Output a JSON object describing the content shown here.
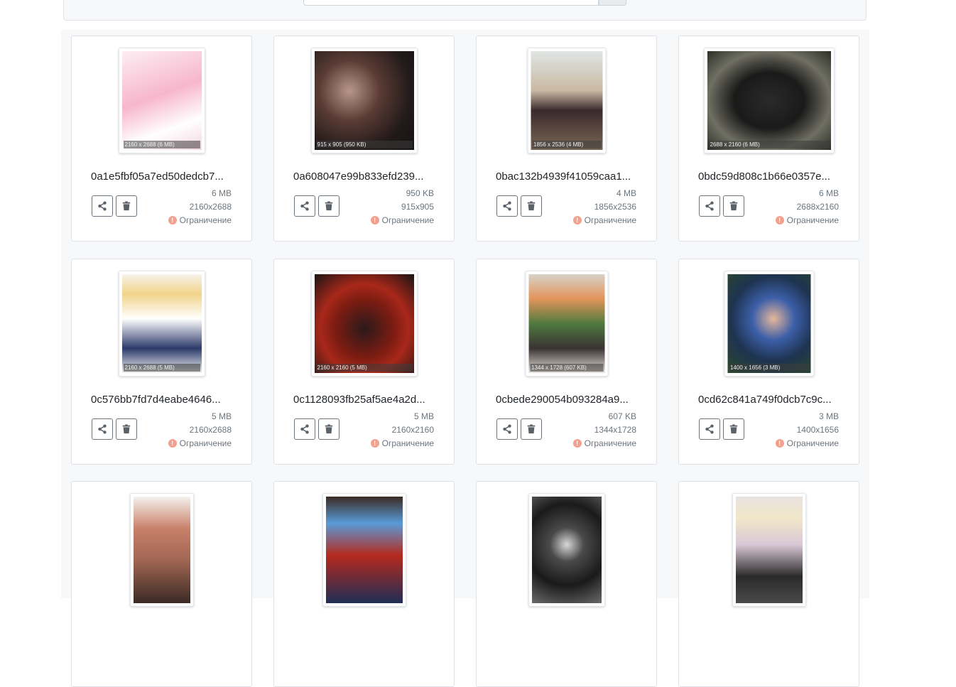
{
  "cards": [
    {
      "name": "0a1e5fbf05a7ed50dedcb7...",
      "size": "6 MB",
      "dims": "2160x2688",
      "restriction": "Ограничение",
      "caption": "2160 x 2688 (6 MB)"
    },
    {
      "name": "0a608047e99b833efd239...",
      "size": "950 KB",
      "dims": "915x905",
      "restriction": "Ограничение",
      "caption": "915 x 905 (950 KB)"
    },
    {
      "name": "0bac132b4939f41059caa1...",
      "size": "4 MB",
      "dims": "1856x2536",
      "restriction": "Ограничение",
      "caption": "1856 x 2536 (4 MB)"
    },
    {
      "name": "0bdc59d808c1b66e0357e...",
      "size": "6 MB",
      "dims": "2688x2160",
      "restriction": "Ограничение",
      "caption": "2688 x 2160 (6 MB)"
    },
    {
      "name": "0c576bb7fd7d4eabe4646...",
      "size": "5 MB",
      "dims": "2160x2688",
      "restriction": "Ограничение",
      "caption": "2160 x 2688 (5 MB)"
    },
    {
      "name": "0c1128093fb25af5ae4a2d...",
      "size": "5 MB",
      "dims": "2160x2160",
      "restriction": "Ограничение",
      "caption": "2160 x 2160 (5 MB)"
    },
    {
      "name": "0cbede290054b093284a9...",
      "size": "607 KB",
      "dims": "1344x1728",
      "restriction": "Ограничение",
      "caption": "1344 x 1728 (607 KB)"
    },
    {
      "name": "0cd62c841a749f0dcb7c9c...",
      "size": "3 MB",
      "dims": "1400x1656",
      "restriction": "Ограничение",
      "caption": "1400 x 1656 (3 MB)"
    }
  ],
  "icons": {
    "share": "share-icon",
    "delete": "trash-icon",
    "restriction": "exclamation-circle-icon"
  },
  "colors": {
    "restriction_icon": "#f3a08f",
    "panel_bg": "#f7f8fa",
    "button_border": "#6c757d"
  }
}
